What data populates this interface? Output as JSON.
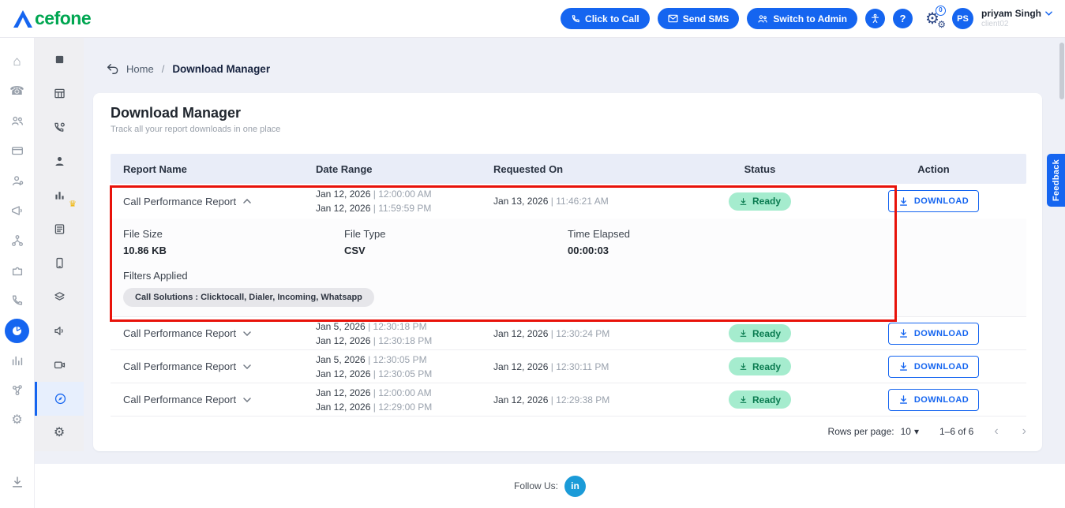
{
  "brand": {
    "full": "Acefone",
    "wordmark_rest": "cefone"
  },
  "header": {
    "buttons": {
      "click_to_call": "Click to Call",
      "send_sms": "Send SMS",
      "switch_to_admin": "Switch to Admin"
    },
    "help": "?",
    "badge_count": "0",
    "user": {
      "initials": "PS",
      "name": "priyam Singh",
      "account": "client02"
    }
  },
  "breadcrumb": {
    "home": "Home",
    "separator": "/",
    "current": "Download Manager"
  },
  "page": {
    "title": "Download Manager",
    "subtitle": "Track all your report downloads in one place"
  },
  "table": {
    "headers": {
      "report_name": "Report Name",
      "date_range": "Date Range",
      "requested_on": "Requested On",
      "status": "Status",
      "action": "Action"
    },
    "rows": [
      {
        "name": "Call Performance Report",
        "range_start_date": "Jan 12, 2026",
        "range_start_time": "| 12:00:00 AM",
        "range_end_date": "Jan 12, 2026",
        "range_end_time": "| 11:59:59 PM",
        "requested_date": "Jan 13, 2026",
        "requested_time": "| 11:46:21 AM",
        "status": "Ready",
        "action": "DOWNLOAD"
      },
      {
        "name": "Call Performance Report",
        "range_start_date": "Jan 5, 2026",
        "range_start_time": "| 12:30:18 PM",
        "range_end_date": "Jan 12, 2026",
        "range_end_time": "| 12:30:18 PM",
        "requested_date": "Jan 12, 2026",
        "requested_time": "| 12:30:24 PM",
        "status": "Ready",
        "action": "DOWNLOAD"
      },
      {
        "name": "Call Performance Report",
        "range_start_date": "Jan 5, 2026",
        "range_start_time": "| 12:30:05 PM",
        "range_end_date": "Jan 12, 2026",
        "range_end_time": "| 12:30:05 PM",
        "requested_date": "Jan 12, 2026",
        "requested_time": "| 12:30:11 PM",
        "status": "Ready",
        "action": "DOWNLOAD"
      },
      {
        "name": "Call Performance Report",
        "range_start_date": "Jan 12, 2026",
        "range_start_time": "| 12:00:00 AM",
        "range_end_date": "Jan 12, 2026",
        "range_end_time": "| 12:29:00 PM",
        "requested_date": "Jan 12, 2026",
        "requested_time": "| 12:29:38 PM",
        "status": "Ready",
        "action": "DOWNLOAD"
      }
    ],
    "expanded_row": {
      "file_size_label": "File Size",
      "file_size": "10.86 KB",
      "file_type_label": "File Type",
      "file_type": "CSV",
      "time_elapsed_label": "Time Elapsed",
      "time_elapsed": "00:00:03",
      "filters_label": "Filters Applied",
      "filters_value": "Call Solutions : Clicktocall, Dialer, Incoming, Whatsapp"
    }
  },
  "pagination": {
    "rows_per_page_label": "Rows per page:",
    "rows_per_page_value": "10",
    "range": "1–6 of 6"
  },
  "footer": {
    "follow": "Follow Us:"
  },
  "feedback": {
    "label": "Feedback"
  },
  "icons": {
    "home": "⌂",
    "phone": "☎",
    "gear": "⚙",
    "crown": "♛",
    "linkedin": "in",
    "prev": "‹",
    "next": "›",
    "dropdown": "▾"
  },
  "colors": {
    "primary_blue": "#1565f0",
    "brand_green": "#00a651",
    "ready_bg": "#a5ecce",
    "ready_text": "#0a7b50",
    "annotation_red": "#e8120a"
  }
}
